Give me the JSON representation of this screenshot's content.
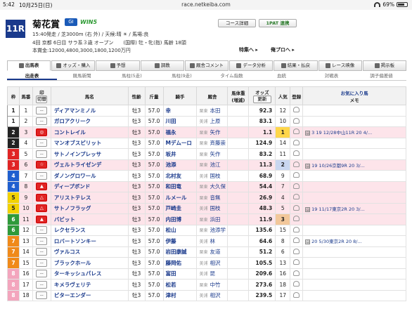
{
  "status": {
    "time": "5:42",
    "date": "10月25日(日)",
    "url": "race.netkeiba.com",
    "battery": "69%"
  },
  "race": {
    "number": "11R",
    "name": "菊花賞",
    "grade": "GI",
    "win5": "WIN5",
    "info1": "15:40発走 / 芝3000m (右 外) / 天候:晴 ☀ / 馬場:良",
    "info2": "4回 京都 6日目 サラ系３歳 オープン　　(国際) 牡・牝(指) 馬齢 18頭",
    "info3": "本賞金:12000,4800,3000,1800,1200万円"
  },
  "buttons": {
    "course": "コース詳細",
    "ipat": "1PAT 連携",
    "tokushu": "特集へ ▸",
    "ore": "俺プロへ ▸"
  },
  "tabs": [
    "出馬表",
    "オッズ・購入",
    "予想",
    "調教",
    "厩舎コメント",
    "データ分析",
    "結果・払戻",
    "レース映像",
    "掲示板"
  ],
  "subtabs": [
    "出走表",
    "競馬新聞",
    "馬柱(5走)",
    "馬柱(9走)",
    "タイム指数",
    "血統",
    "対戦表",
    "調子偏差値"
  ],
  "headers": {
    "waku": "枠",
    "umaban": "馬番",
    "mark": "印",
    "mark_btn": "切替",
    "name": "馬名",
    "sex": "性齢",
    "weight": "斤量",
    "jockey": "騎手",
    "trainer": "厩舎",
    "bw": "馬体重(増減)",
    "odds": "オッズ",
    "odds_btn": "更新",
    "pop": "人気",
    "reg": "登録",
    "fav": "お気に入り馬",
    "memo": "メモ"
  },
  "waku_colors": [
    "#ffffff",
    "#222222",
    "#e02424",
    "#1f5fcf",
    "#f2d200",
    "#2f9a3a",
    "#f08a1a",
    "#f3a5bd"
  ],
  "rows": [
    {
      "w": "1",
      "n": "1",
      "m": "--",
      "name": "ディアマンミノル",
      "sex": "牡3",
      "kin": "57.0",
      "jockey": "幸",
      "reg": "栗東",
      "trainer": "本田",
      "odds": "92.3",
      "pop": "12",
      "memo": ""
    },
    {
      "w": "1",
      "n": "2",
      "m": "--",
      "name": "ガロアクリーク",
      "sex": "牡3",
      "kin": "57.0",
      "jockey": "川田",
      "reg": "美浦",
      "trainer": "上原",
      "odds": "83.1",
      "pop": "10",
      "memo": ""
    },
    {
      "w": "2",
      "n": "3",
      "m": "◎",
      "name": "コントレイル",
      "sex": "牡3",
      "kin": "57.0",
      "jockey": "福永",
      "reg": "栗東",
      "trainer": "矢作",
      "odds": "1.1",
      "pop": "1",
      "memo": "3 19 12/28中山11R 20 4/...",
      "hl": true
    },
    {
      "w": "2",
      "n": "4",
      "m": "--",
      "name": "マンオブスピリット",
      "sex": "牡3",
      "kin": "57.0",
      "jockey": "Mデムーロ",
      "reg": "栗東",
      "trainer": "斉藤崇",
      "odds": "124.9",
      "pop": "14",
      "memo": ""
    },
    {
      "w": "3",
      "n": "5",
      "m": "--",
      "name": "サトノインプレッサ",
      "sex": "牡3",
      "kin": "57.0",
      "jockey": "坂井",
      "reg": "栗東",
      "trainer": "矢作",
      "odds": "83.2",
      "pop": "11",
      "memo": ""
    },
    {
      "w": "3",
      "n": "6",
      "m": "☆",
      "name": "ヴェルトライゼンデ",
      "sex": "牡3",
      "kin": "57.0",
      "jockey": "池添",
      "reg": "栗東",
      "trainer": "池江",
      "odds": "11.3",
      "pop": "2",
      "memo": "19 10/26京都9R 20 3/...",
      "hl": true
    },
    {
      "w": "4",
      "n": "7",
      "m": "--",
      "name": "ダノングロワール",
      "sex": "牡3",
      "kin": "57.0",
      "jockey": "北村友",
      "reg": "美浦",
      "trainer": "国枝",
      "odds": "68.9",
      "pop": "9",
      "memo": ""
    },
    {
      "w": "4",
      "n": "8",
      "m": "▲",
      "name": "ディープボンド",
      "sex": "牡3",
      "kin": "57.0",
      "jockey": "和田竜",
      "reg": "栗東",
      "trainer": "大久保",
      "odds": "54.4",
      "pop": "7",
      "memo": "",
      "hl": true
    },
    {
      "w": "5",
      "n": "9",
      "m": "△",
      "name": "アリストテレス",
      "sex": "牡3",
      "kin": "57.0",
      "jockey": "ルメール",
      "reg": "栗東",
      "trainer": "音無",
      "odds": "26.9",
      "pop": "4",
      "memo": "",
      "hl": true
    },
    {
      "w": "5",
      "n": "10",
      "m": "△",
      "name": "サトノフラッグ",
      "sex": "牡3",
      "kin": "57.0",
      "jockey": "戸崎圭",
      "reg": "美浦",
      "trainer": "国枝",
      "odds": "48.3",
      "pop": "5",
      "memo": "19 11/17東京2R 20 3/...",
      "hl": true
    },
    {
      "w": "6",
      "n": "11",
      "m": "▲",
      "name": "バビット",
      "sex": "牡3",
      "kin": "57.0",
      "jockey": "内田博",
      "reg": "栗東",
      "trainer": "浜田",
      "odds": "11.9",
      "pop": "3",
      "memo": "",
      "hl": true
    },
    {
      "w": "6",
      "n": "12",
      "m": "--",
      "name": "レクセランス",
      "sex": "牡3",
      "kin": "57.0",
      "jockey": "松山",
      "reg": "栗東",
      "trainer": "池添学",
      "odds": "135.6",
      "pop": "15",
      "memo": ""
    },
    {
      "w": "7",
      "n": "13",
      "m": "--",
      "name": "ロバートソンキー",
      "sex": "牡3",
      "kin": "57.0",
      "jockey": "伊藤",
      "reg": "美浦",
      "trainer": "林",
      "odds": "64.6",
      "pop": "8",
      "memo": "20 5/30東京2R 20 8/..."
    },
    {
      "w": "7",
      "n": "14",
      "m": "--",
      "name": "ヴァルコス",
      "sex": "牡3",
      "kin": "57.0",
      "jockey": "岩田康誠",
      "reg": "栗東",
      "trainer": "友道",
      "odds": "51.2",
      "pop": "6",
      "memo": ""
    },
    {
      "w": "7",
      "n": "15",
      "m": "--",
      "name": "ブラックホール",
      "sex": "牡3",
      "kin": "57.0",
      "jockey": "藤岡佑",
      "reg": "美浦",
      "trainer": "相沢",
      "odds": "105.5",
      "pop": "13",
      "memo": ""
    },
    {
      "w": "8",
      "n": "16",
      "m": "--",
      "name": "ターキッシュパレス",
      "sex": "牡3",
      "kin": "57.0",
      "jockey": "富田",
      "reg": "美浦",
      "trainer": "昆",
      "odds": "209.6",
      "pop": "16",
      "memo": ""
    },
    {
      "w": "8",
      "n": "17",
      "m": "--",
      "name": "キメラヴェリテ",
      "sex": "牡3",
      "kin": "57.0",
      "jockey": "松若",
      "reg": "栗東",
      "trainer": "中竹",
      "odds": "273.6",
      "pop": "18",
      "memo": ""
    },
    {
      "w": "8",
      "n": "18",
      "m": "--",
      "name": "ビターエンダー",
      "sex": "牡3",
      "kin": "57.0",
      "jockey": "津村",
      "reg": "美浦",
      "trainer": "相沢",
      "odds": "239.5",
      "pop": "17",
      "memo": ""
    }
  ]
}
